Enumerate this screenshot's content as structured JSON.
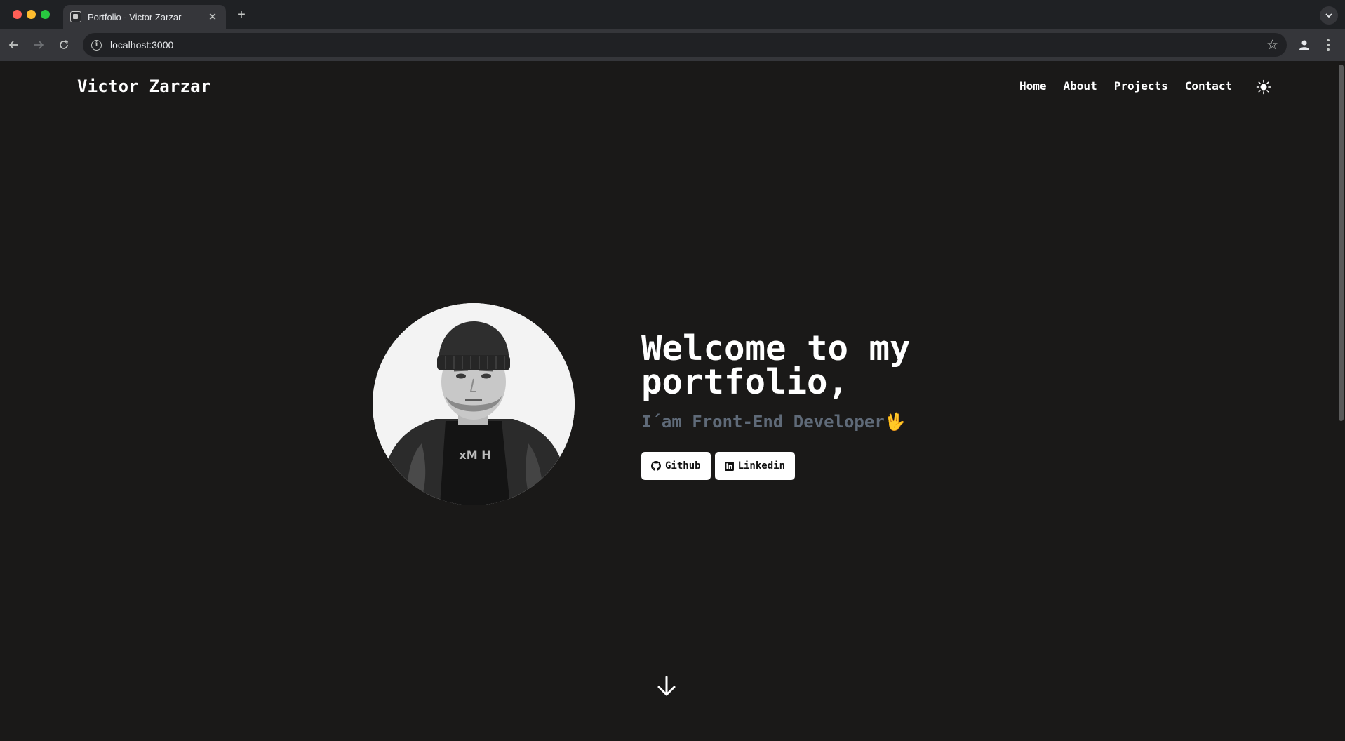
{
  "browser": {
    "tab_title": "Portfolio - Victor Zarzar",
    "tab_close": "✕",
    "new_tab": "+",
    "url": "localhost:3000",
    "info": "i",
    "star": "☆"
  },
  "header": {
    "brand": "Victor Zarzar",
    "nav": [
      "Home",
      "About",
      "Projects",
      "Contact"
    ]
  },
  "hero": {
    "title_line1": "Welcome to my",
    "title_line2": "portfolio,",
    "subtitle": "I´am Front-End Developer",
    "subtitle_emoji": "🖖",
    "buttons": {
      "github": "Github",
      "linkedin": "Linkedin"
    },
    "photo_alt": "profile photo"
  },
  "colors": {
    "background": "#1a1918",
    "text": "#ffffff",
    "subtitle": "#5f6a78"
  }
}
